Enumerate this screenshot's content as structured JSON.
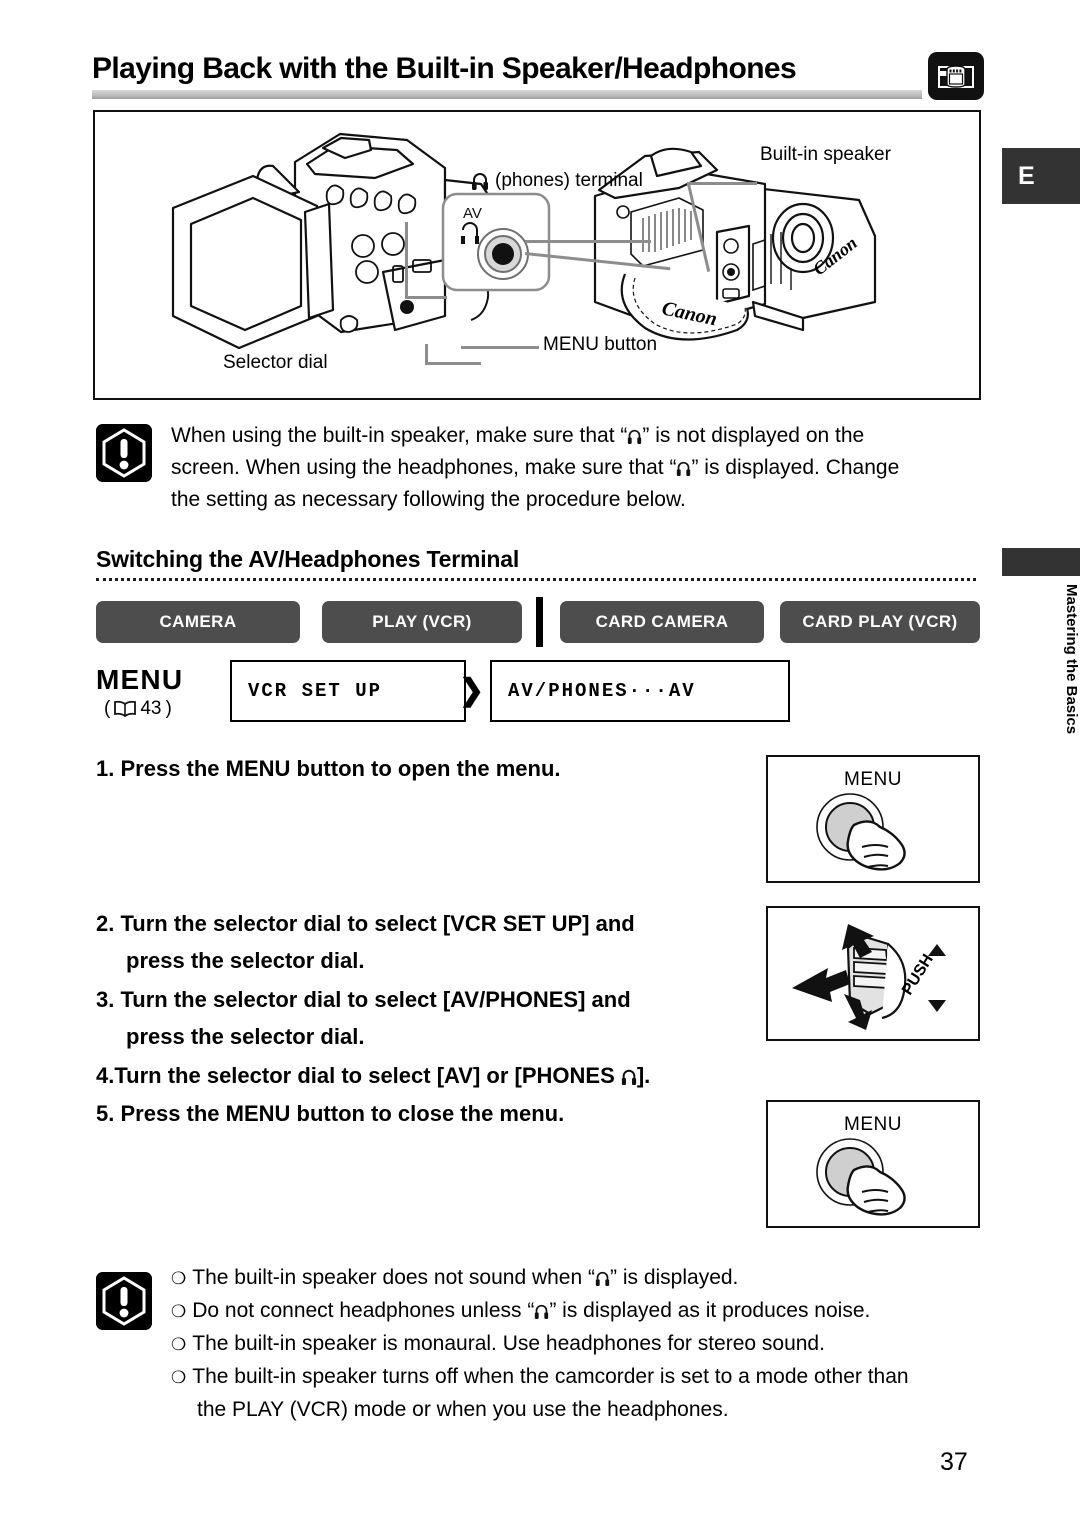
{
  "header": {
    "title": "Playing Back with the Built-in Speaker/Headphones",
    "mode_icon": "camcorder-icon"
  },
  "tabs": {
    "language": "E",
    "section": "Mastering the Basics"
  },
  "diagram": {
    "callouts": [
      {
        "name": "built-in-speaker",
        "text": "Built-in speaker"
      },
      {
        "name": "phones-terminal",
        "text": "(phones) terminal"
      },
      {
        "name": "menu-button",
        "text": "MENU button"
      },
      {
        "name": "selector-dial",
        "text": "Selector dial"
      }
    ],
    "terminal_labels": {
      "av": "AV",
      "phones_symbol": "headphones-icon"
    },
    "brand": "Canon"
  },
  "caution_top": {
    "icon": "exclamation-warning-icon",
    "line1_a": "When using the built-in speaker, make sure that “",
    "line1_b": "” is not displayed on the",
    "line2_a": "screen. When using the headphones, make sure that “",
    "line2_b": "” is displayed. Change",
    "line3": "the setting as necessary following the procedure below."
  },
  "subsection": {
    "title": "Switching the AV/Headphones Terminal"
  },
  "modes": [
    {
      "name": "camera",
      "label": "CAMERA"
    },
    {
      "name": "play-vcr",
      "label": "PLAY (VCR)"
    },
    {
      "name": "card-camera",
      "label": "CARD CAMERA"
    },
    {
      "name": "card-play-vcr",
      "label": "CARD PLAY (VCR)"
    }
  ],
  "menu_path": {
    "menu_word": "MENU",
    "ref_open": "(",
    "ref_page": "43",
    "ref_close": ")",
    "level1": "VCR SET UP",
    "level2": "AV/PHONES···AV",
    "arrow": "❯"
  },
  "steps": [
    {
      "name": "step-1",
      "number": "1.",
      "text": "Press the MENU button to open the menu.",
      "line2": ""
    },
    {
      "name": "step-2",
      "number": "2.",
      "text": "Turn the selector dial to select [VCR SET UP] and",
      "line2": "press the selector dial."
    },
    {
      "name": "step-3",
      "number": "3.",
      "text": "Turn the selector dial to select [AV/PHONES] and",
      "line2": "press the selector dial."
    },
    {
      "name": "step-4",
      "number": "4.",
      "text_a": "Turn the selector dial to select [AV] or [PHONES ",
      "text_b": "]."
    },
    {
      "name": "step-5",
      "number": "5.",
      "text": "Press the MENU button to close the menu.",
      "line2": ""
    }
  ],
  "illustrations": [
    {
      "name": "menu-button-press-top",
      "label": "MENU"
    },
    {
      "name": "selector-dial-turn-push",
      "label": "PUSH"
    },
    {
      "name": "menu-button-press-bottom",
      "label": "MENU"
    }
  ],
  "notes": {
    "icon": "exclamation-warning-icon",
    "items": [
      {
        "a": "The built-in speaker does not sound when “",
        "b": "” is displayed.",
        "cont": ""
      },
      {
        "a": "Do not connect headphones unless “",
        "b": "” is displayed as it produces noise.",
        "cont": ""
      },
      {
        "a": "The built-in speaker is monaural. Use headphones for stereo sound.",
        "b": "",
        "cont": ""
      },
      {
        "a": "The built-in speaker turns off when the camcorder is set to a mode other than",
        "b": "",
        "cont": "the PLAY (VCR) mode or when you use the headphones."
      }
    ],
    "bullet": "❍"
  },
  "page_number": "37",
  "colors": {
    "tab_dark": "#333333",
    "mode_button": "#4d4d4d",
    "rule_gray": "#bdbdbd",
    "leader_gray": "#8d8d8d"
  }
}
